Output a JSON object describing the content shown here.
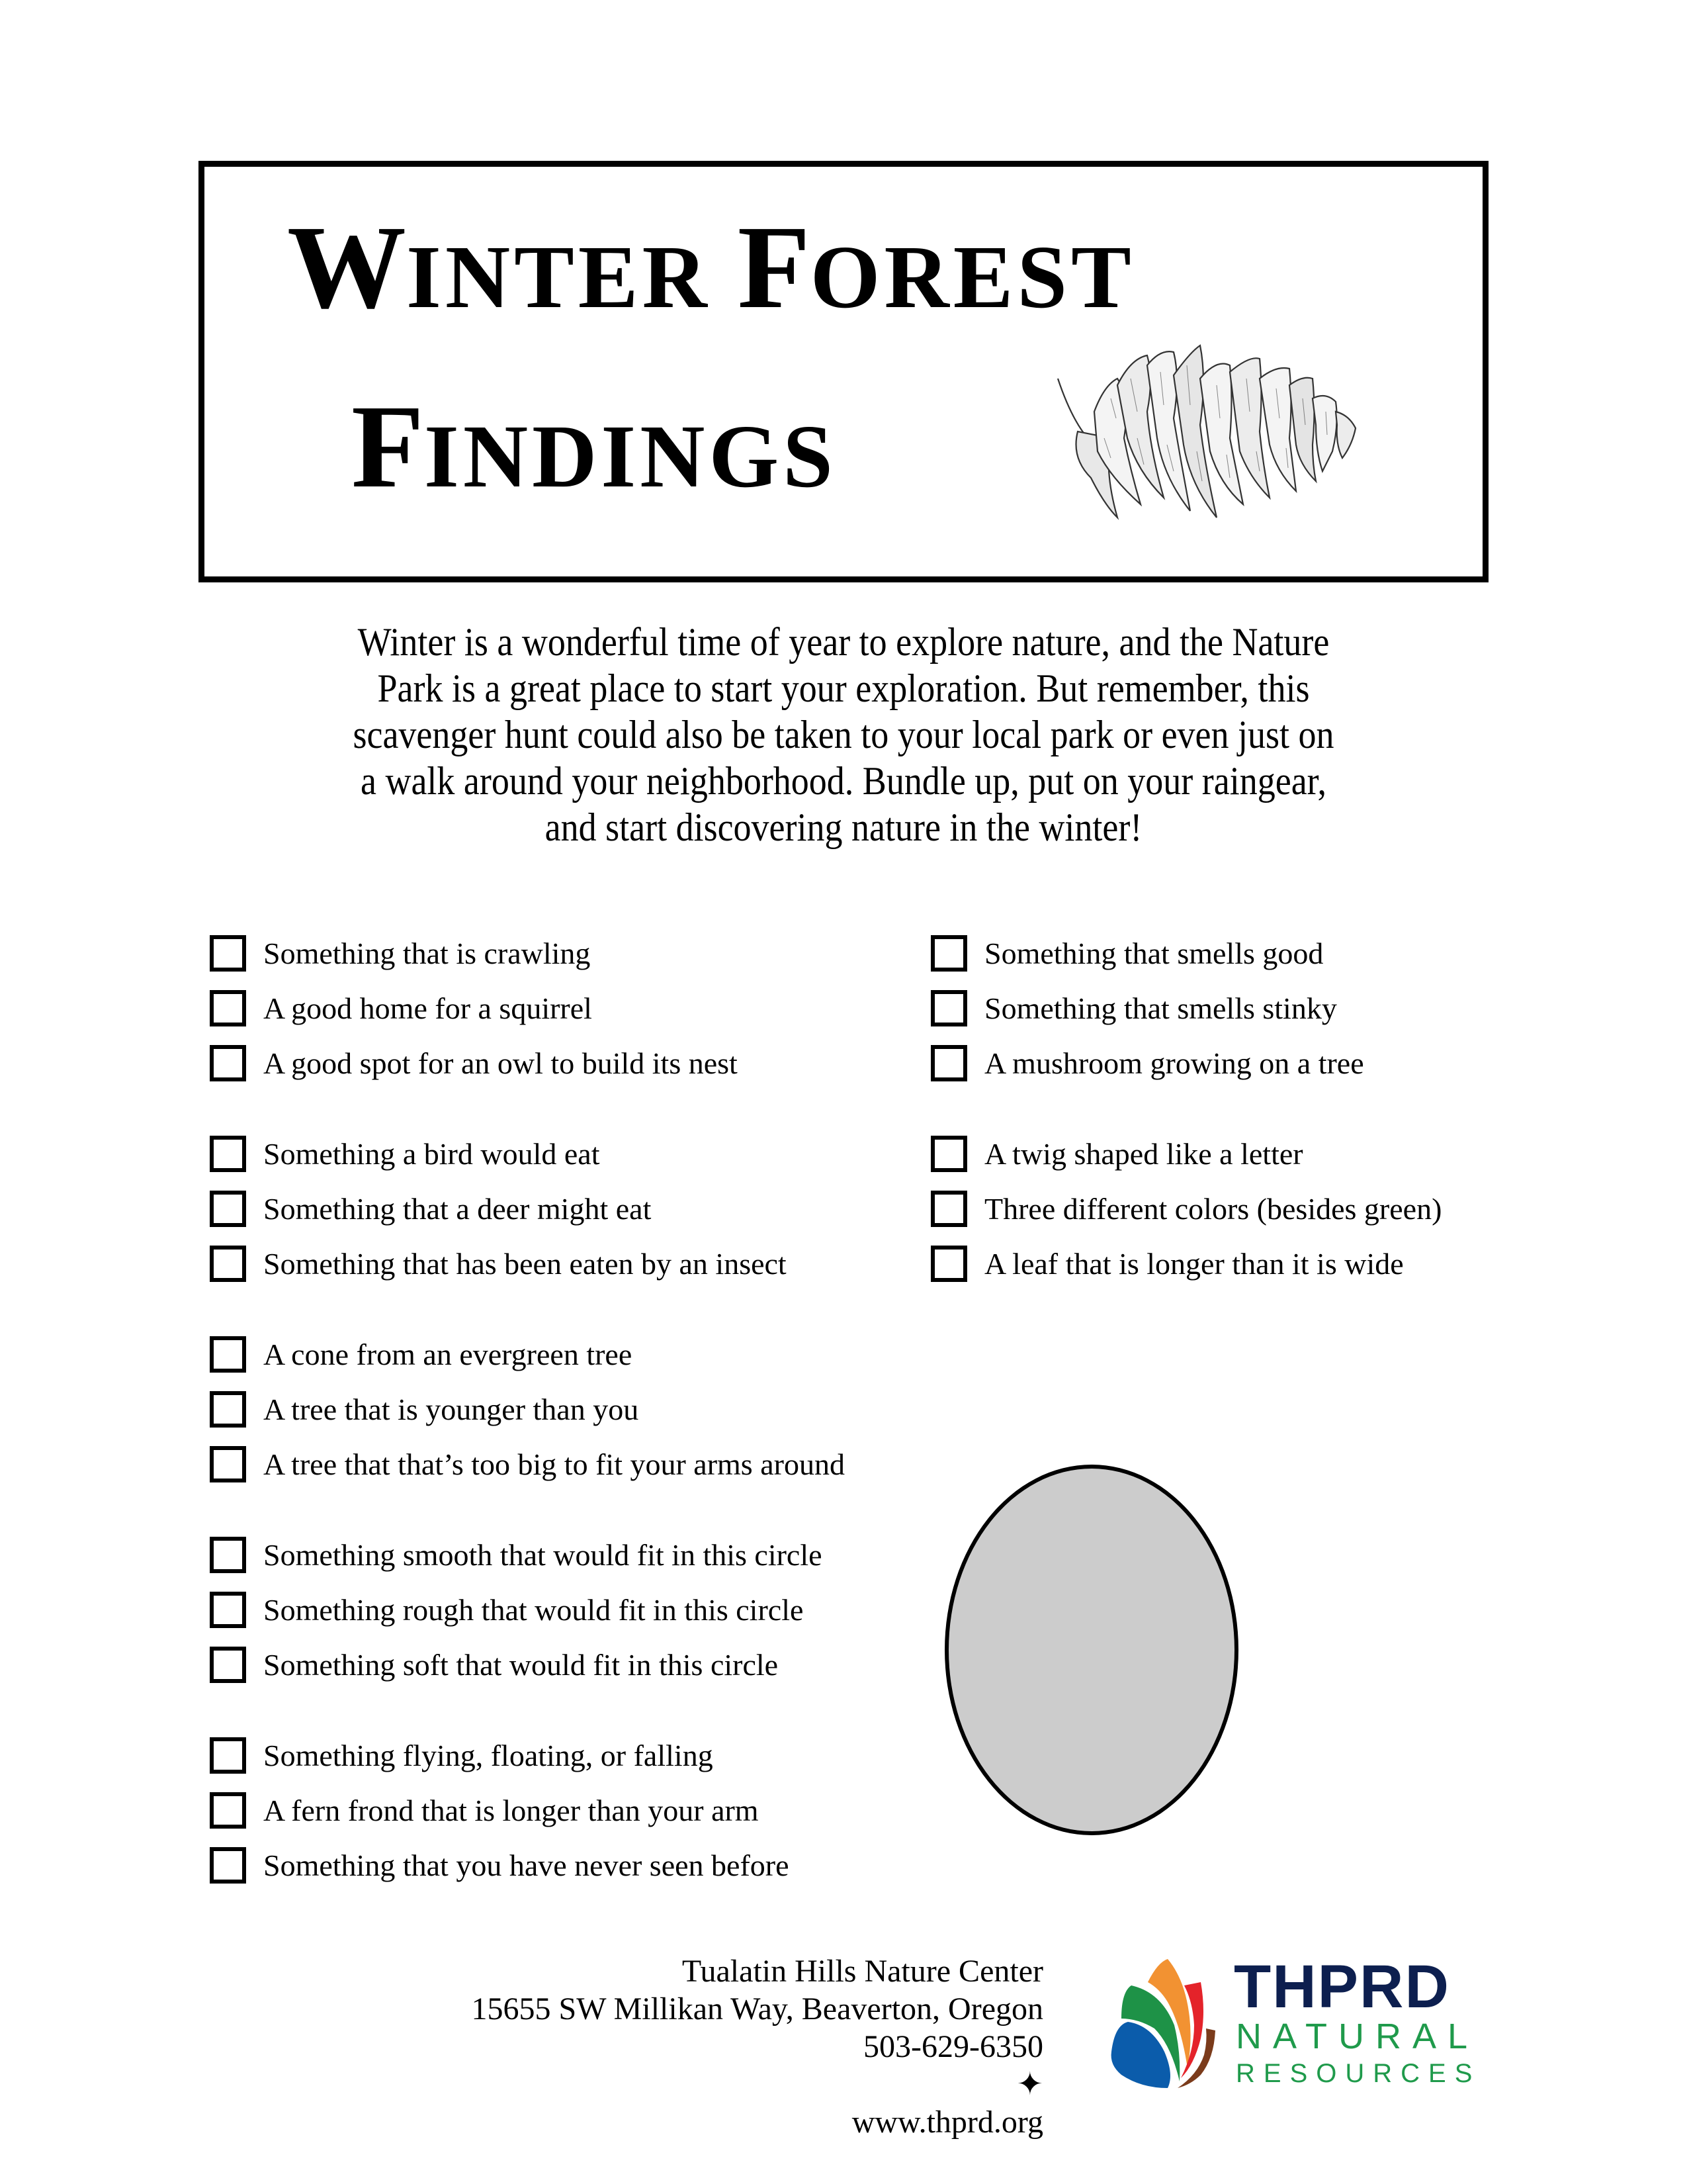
{
  "title": {
    "line1": [
      {
        "cap": "W",
        "rest": "INTER"
      },
      {
        "cap": "F",
        "rest": "OREST"
      }
    ],
    "line2": [
      {
        "cap": "F",
        "rest": "INDINGS"
      }
    ],
    "illustration": "pinecone-drawing"
  },
  "intro": {
    "lines": [
      "Winter is a wonderful time of year to explore nature, and the Nature",
      "Park is a great place to start your exploration.  But remember, this",
      "scavenger hunt could also be taken to your local park or even just on",
      "a walk around your neighborhood.  Bundle up, put on your raingear,",
      "and start discovering nature in the winter!"
    ]
  },
  "checklist": {
    "left_column": [
      [
        "Something that is crawling",
        "A good home for a squirrel",
        "A good spot for an owl to build its nest"
      ],
      [
        "Something a bird would eat",
        "Something that a deer might eat",
        "Something that has been eaten by an insect"
      ],
      [
        "A cone from an evergreen tree",
        "A tree that is younger than you",
        "A tree that that’s too big to fit your arms around"
      ],
      [
        "Something smooth that would fit in this circle",
        "Something rough that would fit in this circle",
        "Something soft that would fit in this circle"
      ],
      [
        "Something flying, floating, or falling",
        "A fern frond that is longer than your arm",
        "Something that you have never seen before"
      ]
    ],
    "right_column": [
      [
        "Something that smells good",
        "Something that smells stinky",
        "A mushroom growing on a tree"
      ],
      [
        "A twig shaped like a letter",
        "Three different colors (besides green)",
        "A leaf that is longer than it is wide"
      ]
    ],
    "checked": false
  },
  "circle": {
    "fill": "#cccccc",
    "purpose": "size-reference-circle"
  },
  "footer": {
    "organization": "Tualatin Hills Nature Center",
    "address": "15655 SW Millikan Way, Beaverton, Oregon",
    "phone": "503-629-6350",
    "separator": "✦",
    "website": "www.thprd.org"
  },
  "logo": {
    "word1": "THPRD",
    "word2": "NATURAL",
    "word3": "RESOURCES",
    "colors": {
      "navy": "#0d1f4f",
      "green": "#1f9a4b",
      "blue": "#0b5cab",
      "leaf_green": "#1e9247",
      "orange": "#f29232",
      "red": "#e4232a",
      "brown": "#7b3b1b"
    }
  }
}
